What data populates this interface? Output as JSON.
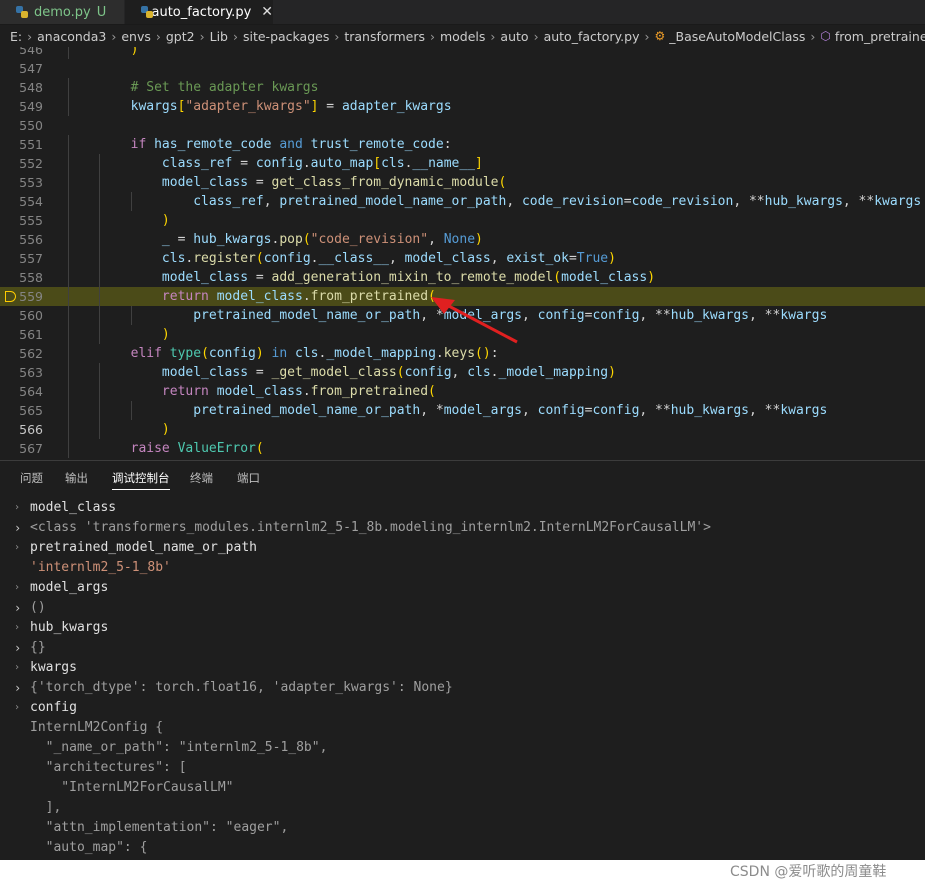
{
  "tabs": [
    {
      "label": "demo.py",
      "status": "U"
    },
    {
      "label": "auto_factory.py",
      "close": "✕"
    }
  ],
  "breadcrumb": [
    "E:",
    "anaconda3",
    "envs",
    "gpt2",
    "Lib",
    "site-packages",
    "transformers",
    "models",
    "auto",
    "auto_factory.py",
    "_BaseAutoModelClass",
    "from_pretrained"
  ],
  "editor": {
    "current_line": 559,
    "active_line": 566,
    "lines": [
      {
        "num": "546",
        "text": "        )"
      },
      {
        "num": "547",
        "text": ""
      },
      {
        "num": "548",
        "text": "        # Set the adapter kwargs"
      },
      {
        "num": "549",
        "text": "        kwargs[\"adapter_kwargs\"] = adapter_kwargs"
      },
      {
        "num": "550",
        "text": ""
      },
      {
        "num": "551",
        "text": "        if has_remote_code and trust_remote_code:"
      },
      {
        "num": "552",
        "text": "            class_ref = config.auto_map[cls.__name__]"
      },
      {
        "num": "553",
        "text": "            model_class = get_class_from_dynamic_module("
      },
      {
        "num": "554",
        "text": "                class_ref, pretrained_model_name_or_path, code_revision=code_revision, **hub_kwargs, **kwargs"
      },
      {
        "num": "555",
        "text": "            )"
      },
      {
        "num": "556",
        "text": "            _ = hub_kwargs.pop(\"code_revision\", None)"
      },
      {
        "num": "557",
        "text": "            cls.register(config.__class__, model_class, exist_ok=True)"
      },
      {
        "num": "558",
        "text": "            model_class = add_generation_mixin_to_remote_model(model_class)"
      },
      {
        "num": "559",
        "text": "            return model_class.from_pretrained("
      },
      {
        "num": "560",
        "text": "                pretrained_model_name_or_path, *model_args, config=config, **hub_kwargs, **kwargs"
      },
      {
        "num": "561",
        "text": "            )"
      },
      {
        "num": "562",
        "text": "        elif type(config) in cls._model_mapping.keys():"
      },
      {
        "num": "563",
        "text": "            model_class = _get_model_class(config, cls._model_mapping)"
      },
      {
        "num": "564",
        "text": "            return model_class.from_pretrained("
      },
      {
        "num": "565",
        "text": "                pretrained_model_name_or_path, *model_args, config=config, **hub_kwargs, **kwargs"
      },
      {
        "num": "566",
        "text": "            )"
      },
      {
        "num": "567",
        "text": "        raise ValueError("
      }
    ]
  },
  "panel": {
    "tabs": [
      "问题",
      "输出",
      "调试控制台",
      "终端",
      "端口"
    ],
    "active_tab": "调试控制台",
    "console": [
      {
        "kind": "input",
        "text": "model_class"
      },
      {
        "kind": "result",
        "expandable": true,
        "text": "<class 'transformers_modules.internlm2_5-1_8b.modeling_internlm2.InternLM2ForCausalLM'>"
      },
      {
        "kind": "input",
        "text": "pretrained_model_name_or_path"
      },
      {
        "kind": "result-str",
        "expandable": false,
        "text": "'internlm2_5-1_8b'"
      },
      {
        "kind": "input",
        "text": "model_args"
      },
      {
        "kind": "result",
        "expandable": true,
        "text": "()"
      },
      {
        "kind": "input",
        "text": "hub_kwargs"
      },
      {
        "kind": "result",
        "expandable": true,
        "text": "{}"
      },
      {
        "kind": "input",
        "text": "kwargs"
      },
      {
        "kind": "result",
        "expandable": true,
        "text": "{'torch_dtype': torch.float16, 'adapter_kwargs': None}"
      },
      {
        "kind": "input",
        "text": "config"
      },
      {
        "kind": "result",
        "expandable": false,
        "text": "InternLM2Config {"
      },
      {
        "kind": "result",
        "expandable": false,
        "text": "  \"_name_or_path\": \"internlm2_5-1_8b\","
      },
      {
        "kind": "result",
        "expandable": false,
        "text": "  \"architectures\": ["
      },
      {
        "kind": "result",
        "expandable": false,
        "text": "    \"InternLM2ForCausalLM\""
      },
      {
        "kind": "result",
        "expandable": false,
        "text": "  ],"
      },
      {
        "kind": "result",
        "expandable": false,
        "text": "  \"attn_implementation\": \"eager\","
      },
      {
        "kind": "result",
        "expandable": false,
        "text": "  \"auto_map\": {"
      }
    ]
  },
  "watermark": "CSDN @爱听歌的周童鞋",
  "colors": {
    "current_line_bg": "#4b4b18",
    "arrow": "#e02020",
    "debug_marker": "#ffcc00"
  }
}
